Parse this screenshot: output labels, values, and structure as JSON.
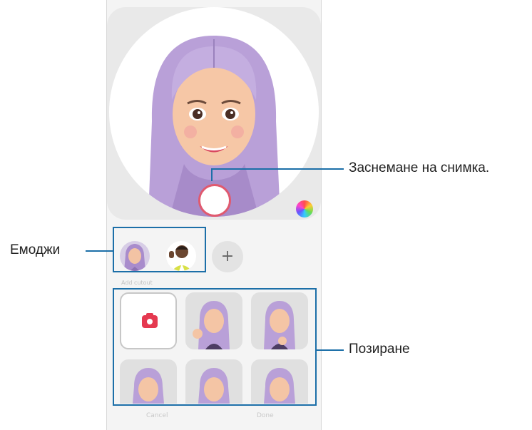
{
  "callouts": {
    "capture": "Заснемане на снимка.",
    "emoji": "Емоджи",
    "poses": "Позиране"
  },
  "panel": {
    "section_label": "Add cutout",
    "add_button": "+"
  },
  "bottom_bar": {
    "cancel": "Cancel",
    "done": "Done"
  },
  "colors": {
    "callout_line": "#1c6fa8",
    "shutter_ring": "#e05a6f",
    "camera_icon": "#e53950",
    "hair": "#b9a0d8"
  }
}
